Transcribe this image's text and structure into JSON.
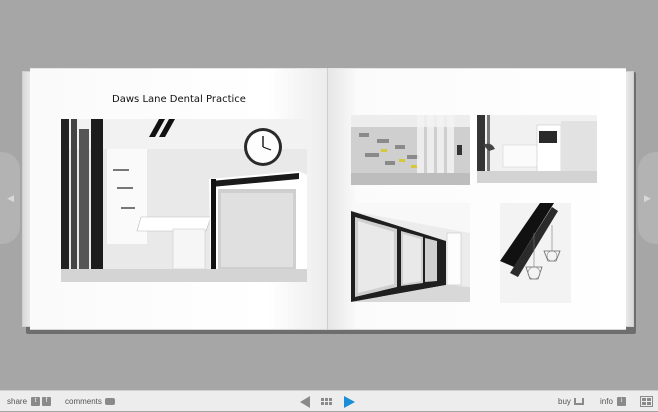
{
  "book": {
    "left_page": {
      "title": "Daws Lane Dental Practice"
    },
    "photos": [
      {
        "name": "reception-photo",
        "alt_icon": "photo"
      },
      {
        "name": "glass-partition-photo",
        "alt_icon": "photo"
      },
      {
        "name": "treatment-room-photo",
        "alt_icon": "photo"
      },
      {
        "name": "corridor-panels-photo",
        "alt_icon": "photo"
      },
      {
        "name": "pendant-lights-photo",
        "alt_icon": "photo"
      }
    ]
  },
  "toolbar": {
    "share_label": "share",
    "share_icon_t": "t",
    "share_icon_f": "f",
    "comments_label": "comments",
    "buy_label": "buy",
    "info_label": "info",
    "info_icon": "i"
  },
  "colors": {
    "background": "#a6a6a6",
    "toolbar": "#ededed",
    "play_button": "#1a8fd6",
    "icons": "#8a8a8a"
  }
}
